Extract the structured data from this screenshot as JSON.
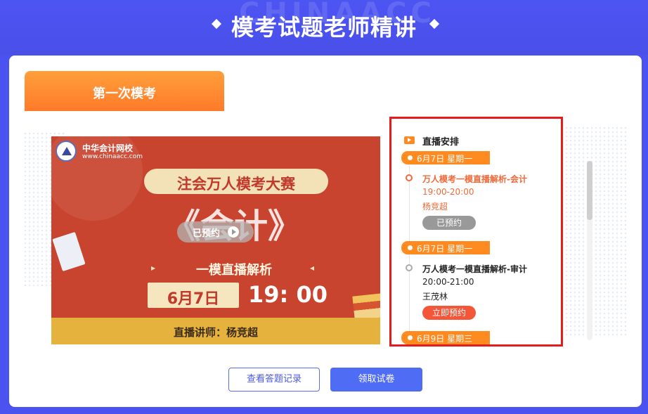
{
  "header": {
    "title": "模考试题老师精讲",
    "watermark": "CHINAACC"
  },
  "tab": {
    "label": "第一次模考"
  },
  "poster": {
    "logo_name": "中华会计网校",
    "logo_url": "www.chinaacc.com",
    "headline": "注会万人模考大赛",
    "subject": "《会计》",
    "subtitle": "一模直播解析",
    "arrow_left": "▸",
    "arrow_right": "◂",
    "date": "6月7日",
    "time": "19: 00",
    "lecturer": "直播讲师：杨竞超",
    "overlay_button": "已预约"
  },
  "schedule": {
    "title": "直播安排",
    "dates": [
      "6月7日  星期一",
      "6月7日  星期一",
      "6月9日  星期三"
    ],
    "items": [
      {
        "title": "万人模考一模直播解析-会计",
        "time": "19:00-20:00",
        "teacher": "杨竞超",
        "button": "已预约",
        "status": "reserved"
      },
      {
        "title": "万人模考一模直播解析-审计",
        "time": "20:00-21:00",
        "teacher": "王茂林",
        "button": "立即预约",
        "status": "open"
      }
    ]
  },
  "actions": {
    "view_records": "查看答题记录",
    "get_paper": "领取试卷"
  },
  "colors": {
    "brand_blue": "#4a52f0",
    "accent_orange": "#ff8a1f",
    "highlight_red": "#e51c1c",
    "reserve_red": "#f4563a"
  }
}
